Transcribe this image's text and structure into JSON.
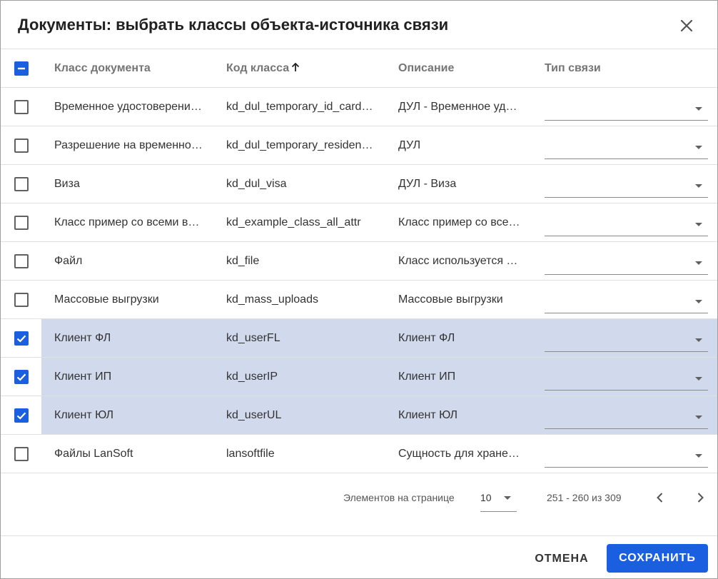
{
  "dialog": {
    "title": "Документы: выбрать классы объекта-источника связи"
  },
  "table": {
    "columns": {
      "name": "Класс документа",
      "code": "Код класса",
      "description": "Описание",
      "link_type": "Тип связи"
    },
    "header_checkbox_state": "indeterminate",
    "sort": {
      "column": "code",
      "direction": "asc"
    },
    "rows": [
      {
        "name": "Временное удостоверени…",
        "code": "kd_dul_temporary_id_cardRF",
        "description": "ДУЛ - Временное уд…",
        "link_type": "",
        "checked": false
      },
      {
        "name": "Разрешение на временно…",
        "code": "kd_dul_temporary_residenc…",
        "description": "ДУЛ",
        "link_type": "",
        "checked": false
      },
      {
        "name": "Виза",
        "code": "kd_dul_visa",
        "description": "ДУЛ - Виза",
        "link_type": "",
        "checked": false
      },
      {
        "name": "Класс пример со всеми в…",
        "code": "kd_example_class_all_attr",
        "description": "Класс пример со все…",
        "link_type": "",
        "checked": false
      },
      {
        "name": "Файл",
        "code": "kd_file",
        "description": "Класс используется …",
        "link_type": "",
        "checked": false
      },
      {
        "name": "Массовые выгрузки",
        "code": "kd_mass_uploads",
        "description": "Массовые выгрузки",
        "link_type": "",
        "checked": false
      },
      {
        "name": "Клиент ФЛ",
        "code": "kd_userFL",
        "description": "Клиент ФЛ",
        "link_type": "",
        "checked": true
      },
      {
        "name": "Клиент ИП",
        "code": "kd_userIP",
        "description": "Клиент ИП",
        "link_type": "",
        "checked": true
      },
      {
        "name": "Клиент ЮЛ",
        "code": "kd_userUL",
        "description": "Клиент ЮЛ",
        "link_type": "",
        "checked": true
      },
      {
        "name": "Файлы LanSoft",
        "code": "lansoftfile",
        "description": "Сущность для хране…",
        "link_type": "",
        "checked": false
      }
    ]
  },
  "paginator": {
    "items_per_page_label": "Элементов на странице",
    "page_size": "10",
    "range_label": "251 - 260 из 309"
  },
  "actions": {
    "cancel_label": "ОТМЕНА",
    "save_label": "СОХРАНИТЬ"
  },
  "colors": {
    "accent": "#1a5fe0",
    "selected_row": "#d1d9ed"
  }
}
